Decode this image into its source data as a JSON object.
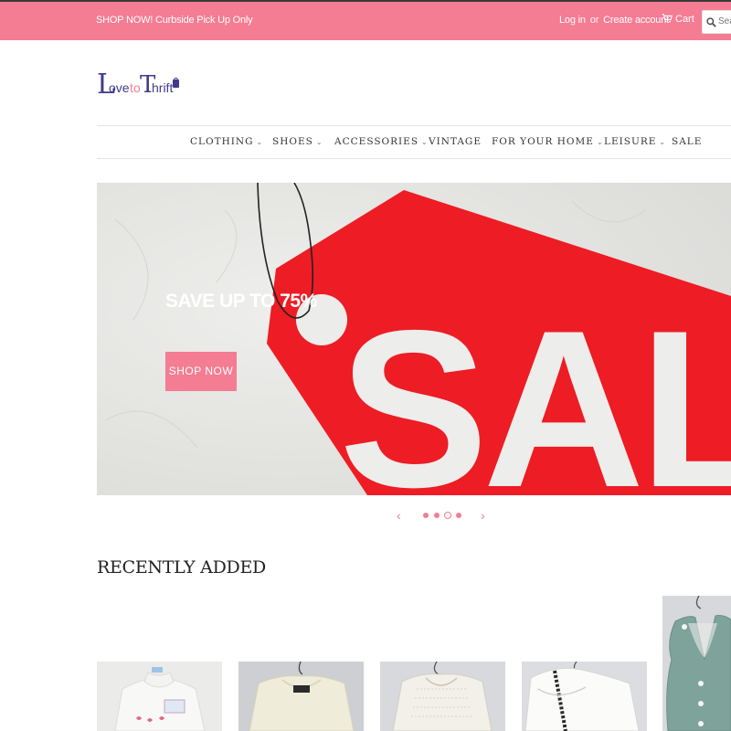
{
  "announcement": {
    "text": "SHOP NOW! Curbside Pick Up Only"
  },
  "account": {
    "login": "Log in",
    "separator": "or",
    "create": "Create account"
  },
  "cart": {
    "label": "Cart",
    "icon": "cart-icon"
  },
  "search": {
    "placeholder": "Search",
    "icon": "search-icon"
  },
  "logo": {
    "text_love": "Love",
    "text_to": "to",
    "text_thrift": "Thrift"
  },
  "nav": {
    "items": [
      {
        "label": "CLOTHING",
        "has_dropdown": true
      },
      {
        "label": "SHOES",
        "has_dropdown": true
      },
      {
        "label": "ACCESSORIES",
        "has_dropdown": true
      },
      {
        "label": "VINTAGE",
        "has_dropdown": false
      },
      {
        "label": "FOR YOUR HOME",
        "has_dropdown": true
      },
      {
        "label": "LEISURE",
        "has_dropdown": true
      },
      {
        "label": "SALE",
        "has_dropdown": false
      }
    ],
    "chevron": "⌄"
  },
  "hero": {
    "heading": "SAVE UP TO 75%",
    "button": "SHOP NOW",
    "tag_text": "SALE"
  },
  "slider": {
    "prev": "‹",
    "next": "›",
    "slide_count": 3,
    "active_index": 1
  },
  "recent": {
    "title": "RECENTLY ADDED"
  },
  "colors": {
    "brand_pink": "#f47c93",
    "sale_red": "#ee1c24",
    "logo_purple": "#3f3a8c"
  }
}
